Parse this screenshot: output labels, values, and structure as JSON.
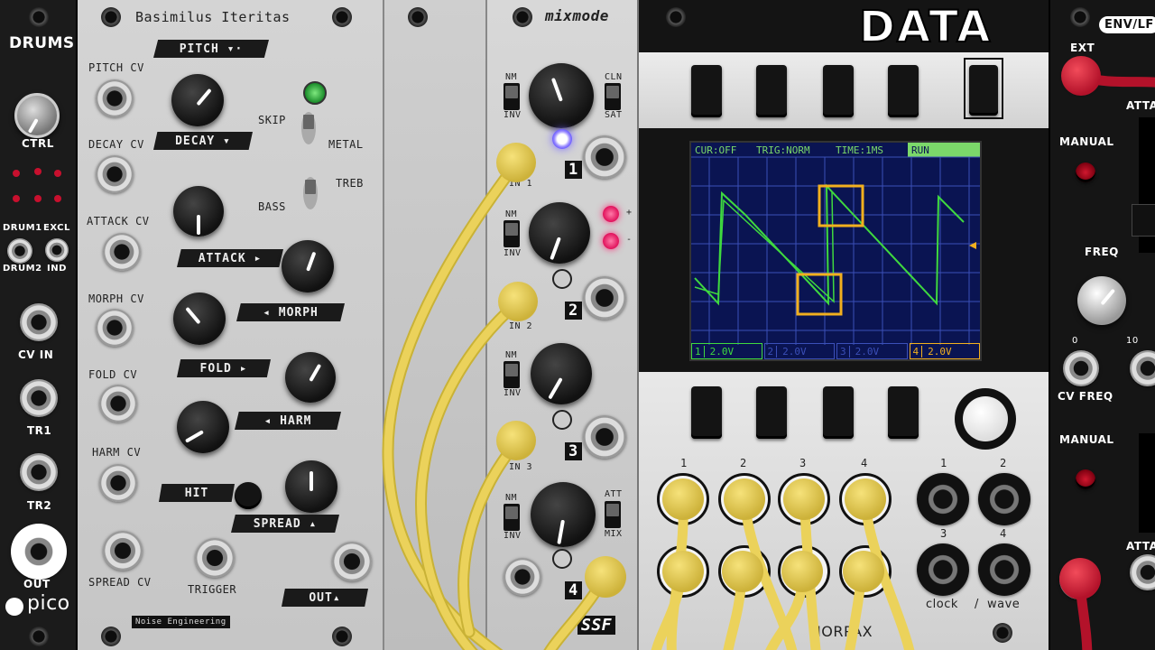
{
  "drums": {
    "title": "DRUMS",
    "ctrl_label": "CTRL",
    "drum1": "DRUM1",
    "excl": "EXCL",
    "drum2": "DRUM2",
    "ind": "IND",
    "cv_in": "CV IN",
    "tr1": "TR1",
    "tr2": "TR2",
    "out": "OUT",
    "brand": "pico"
  },
  "basimilus": {
    "title": "Basimilus Iteritas",
    "pitch": "PITCH ▾·",
    "pitch_cv": "PITCH CV",
    "decay": "DECAY ▾",
    "decay_cv": "DECAY CV",
    "skip": "SKIP",
    "metal": "METAL",
    "treb": "TREB",
    "bass": "BASS",
    "attack_cv": "ATTACK CV",
    "attack": "ATTACK ▸",
    "morph_cv": "MORPH CV",
    "morph": "◂ MORPH",
    "fold_cv": "FOLD CV",
    "fold": "FOLD ▸",
    "harm": "◂ HARM",
    "harm_cv": "HARM CV",
    "hit": "HIT",
    "spread": "SPREAD ▴",
    "spread_cv": "SPREAD CV",
    "trigger": "TRIGGER",
    "out": "OUT▴",
    "maker": "Noise Engineering"
  },
  "mixmode": {
    "title": "mixmode",
    "nm": "NM",
    "inv": "INV",
    "cln": "CLN",
    "sat": "SAT",
    "att": "ATT",
    "mix": "MIX",
    "in1": "IN 1",
    "in2": "IN 2",
    "in3": "IN 3",
    "ch1": "1",
    "ch2": "2",
    "ch3": "3",
    "ch4": "4",
    "plus": "+",
    "minus": "-",
    "brand": "SSF"
  },
  "data": {
    "title": "DATA",
    "screen": {
      "cur": "CUR:OFF",
      "trig": "TRIG:NORM",
      "time": "TIME:1MS",
      "run": "RUN"
    },
    "channels": [
      {
        "n": "1",
        "v": "2.0V"
      },
      {
        "n": "2",
        "v": "2.0V"
      },
      {
        "n": "3",
        "v": "2.0V"
      },
      {
        "n": "4",
        "v": "2.0V"
      }
    ],
    "inputs": [
      "1",
      "2",
      "3",
      "4"
    ],
    "outs": [
      "1",
      "2",
      "3",
      "4"
    ],
    "clock": "clock",
    "slash": "/",
    "wave": "wave",
    "maker": "MORPAX",
    "colors": {
      "screen_bg": "#0a1452",
      "trace": "#3fd93f",
      "highlight": "#f2b01e",
      "header": "#7bd86a"
    }
  },
  "envlfo": {
    "title": "ENV/LF",
    "ext": "EXT",
    "manual1": "MANUAL",
    "freq": "FREQ",
    "zero": "0",
    "ten": "10",
    "cv_freq": "CV FREQ",
    "manual2": "MANUAL",
    "atta": "ATTA"
  }
}
